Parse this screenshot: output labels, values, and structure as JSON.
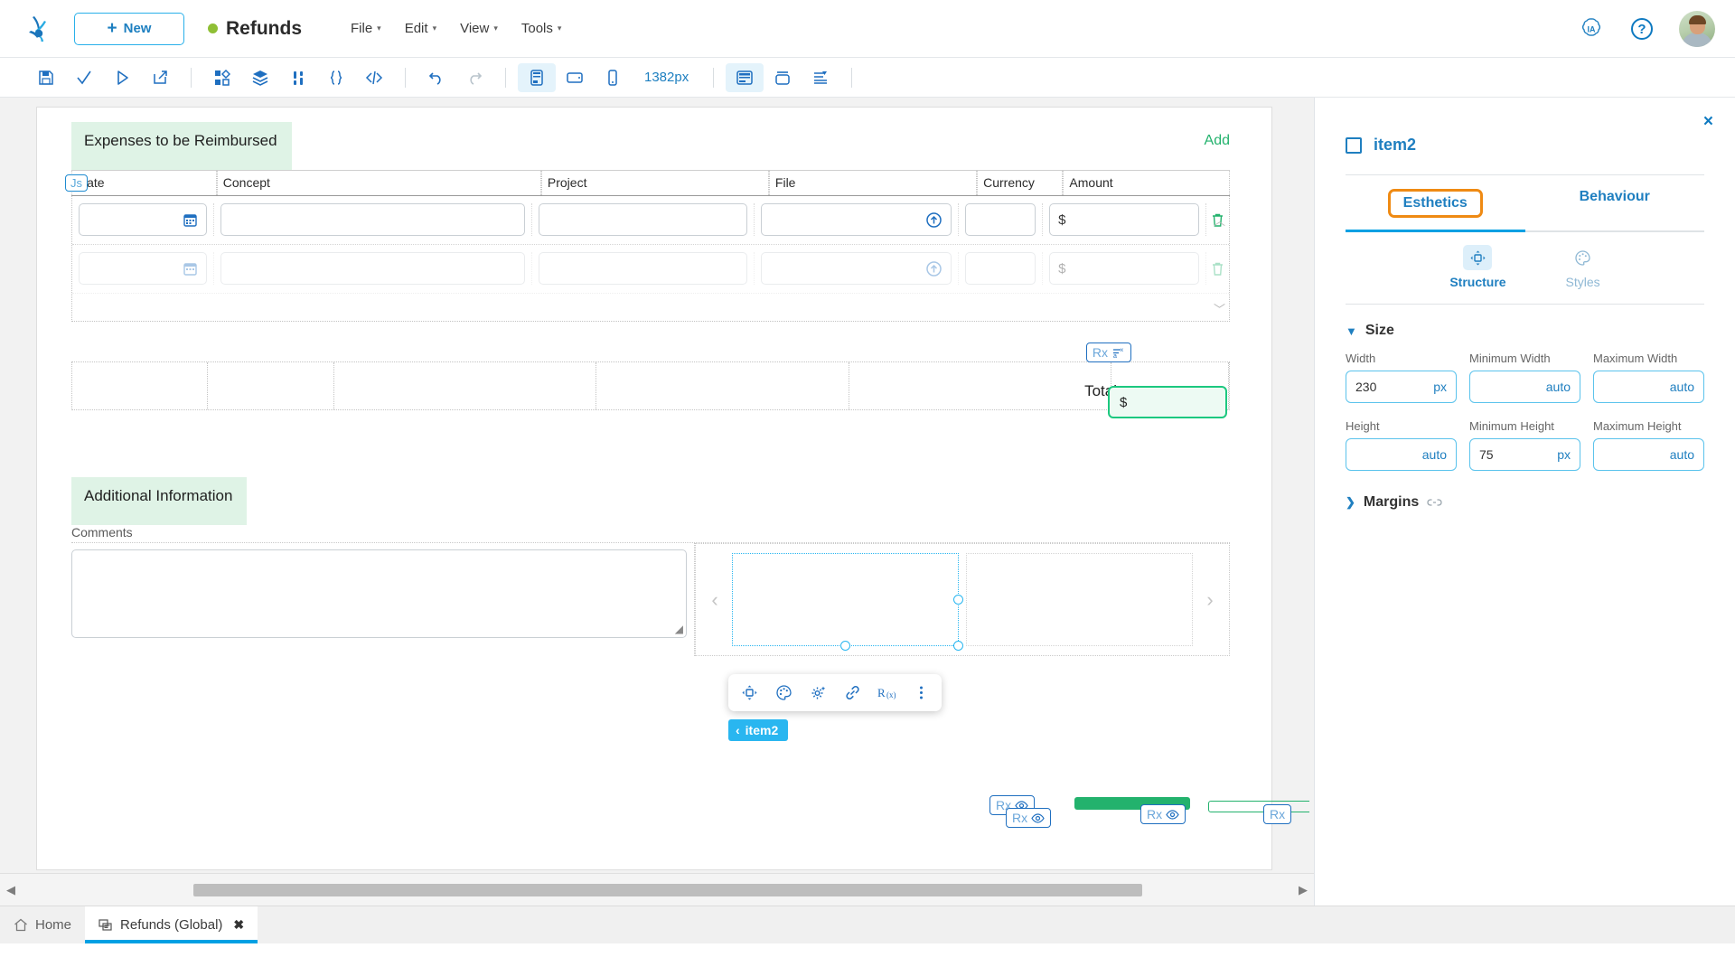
{
  "topbar": {
    "logo_name": "bizagi-logo",
    "new_button": "New",
    "app_title": "Refunds",
    "status": "published",
    "menus": [
      {
        "label": "File"
      },
      {
        "label": "Edit"
      },
      {
        "label": "View"
      },
      {
        "label": "Tools"
      }
    ],
    "ai_badge": "IA",
    "help": "?",
    "avatar": "user-avatar"
  },
  "toolbar": {
    "zoom_value": "1382px",
    "buttons": [
      {
        "name": "save-icon"
      },
      {
        "name": "validate-check-icon"
      },
      {
        "name": "run-play-icon"
      },
      {
        "name": "publish-export-icon"
      },
      {
        "name": "widgets-grid-icon"
      },
      {
        "name": "layers-stack-icon"
      },
      {
        "name": "rules-icon"
      },
      {
        "name": "expression-braces-icon"
      },
      {
        "name": "code-icon"
      },
      {
        "name": "undo-icon"
      },
      {
        "name": "redo-icon"
      },
      {
        "name": "desktop-view-icon"
      },
      {
        "name": "tablet-view-icon"
      },
      {
        "name": "mobile-view-icon"
      },
      {
        "name": "layout-grid-icon"
      },
      {
        "name": "container-icon"
      },
      {
        "name": "align-icon"
      }
    ]
  },
  "canvas": {
    "expenses": {
      "title": "Expenses to be Reimbursed",
      "add_label": "Add",
      "js_badge": "Js",
      "columns": [
        {
          "label": "Date"
        },
        {
          "label": "Concept"
        },
        {
          "label": "Project"
        },
        {
          "label": "File"
        },
        {
          "label": "Currency"
        },
        {
          "label": "Amount"
        }
      ],
      "rows": [
        {
          "date": "",
          "concept": "",
          "project": "",
          "file": "",
          "currency": "",
          "amount": "$",
          "ghost": false
        },
        {
          "date": "",
          "concept": "",
          "project": "",
          "file": "",
          "currency": "",
          "amount": "$",
          "ghost": true
        }
      ]
    },
    "totals": {
      "label": "Total",
      "value": "$",
      "rx_badge": "Rx"
    },
    "additional": {
      "title": "Additional Information",
      "comments_label": "Comments",
      "comments_value": ""
    },
    "selection": {
      "tag_label": "item2"
    },
    "float_toolbar": [
      {
        "name": "structure-move-icon"
      },
      {
        "name": "palette-icon"
      },
      {
        "name": "settings-sparkle-icon"
      },
      {
        "name": "link-icon"
      },
      {
        "name": "formula-rx-icon"
      },
      {
        "name": "more-vertical-icon"
      }
    ],
    "bottom_badges": [
      {
        "label": "Rx"
      },
      {
        "label": "Rx"
      },
      {
        "label": "Rx"
      },
      {
        "label": "Rx"
      }
    ]
  },
  "panel": {
    "element_name": "item2",
    "close": "×",
    "tabs": [
      {
        "label": "Esthetics",
        "active": true,
        "highlighted": true
      },
      {
        "label": "Behaviour",
        "active": false,
        "highlighted": false
      }
    ],
    "subtabs": [
      {
        "label": "Structure",
        "active": true
      },
      {
        "label": "Styles",
        "active": false
      }
    ],
    "size": {
      "section_label": "Size",
      "fields": [
        {
          "label": "Width",
          "value": "230",
          "unit": "px"
        },
        {
          "label": "Minimum Width",
          "value": "auto",
          "unit": ""
        },
        {
          "label": "Maximum Width",
          "value": "auto",
          "unit": ""
        },
        {
          "label": "Height",
          "value": "auto",
          "unit": ""
        },
        {
          "label": "Minimum Height",
          "value": "75",
          "unit": "px"
        },
        {
          "label": "Maximum Height",
          "value": "auto",
          "unit": ""
        }
      ]
    },
    "margins_label": "Margins"
  },
  "bottom_tabs": [
    {
      "label": "Home",
      "icon": "home-icon",
      "active": false,
      "closable": false
    },
    {
      "label": "Refunds (Global)",
      "icon": "form-icon",
      "active": true,
      "closable": true
    }
  ],
  "colors": {
    "accent_blue": "#00a0e3",
    "link_blue": "#1f7fc0",
    "green": "#23b26d",
    "orange_highlight": "#ef8a13",
    "selection_cyan": "#29b6f0"
  }
}
